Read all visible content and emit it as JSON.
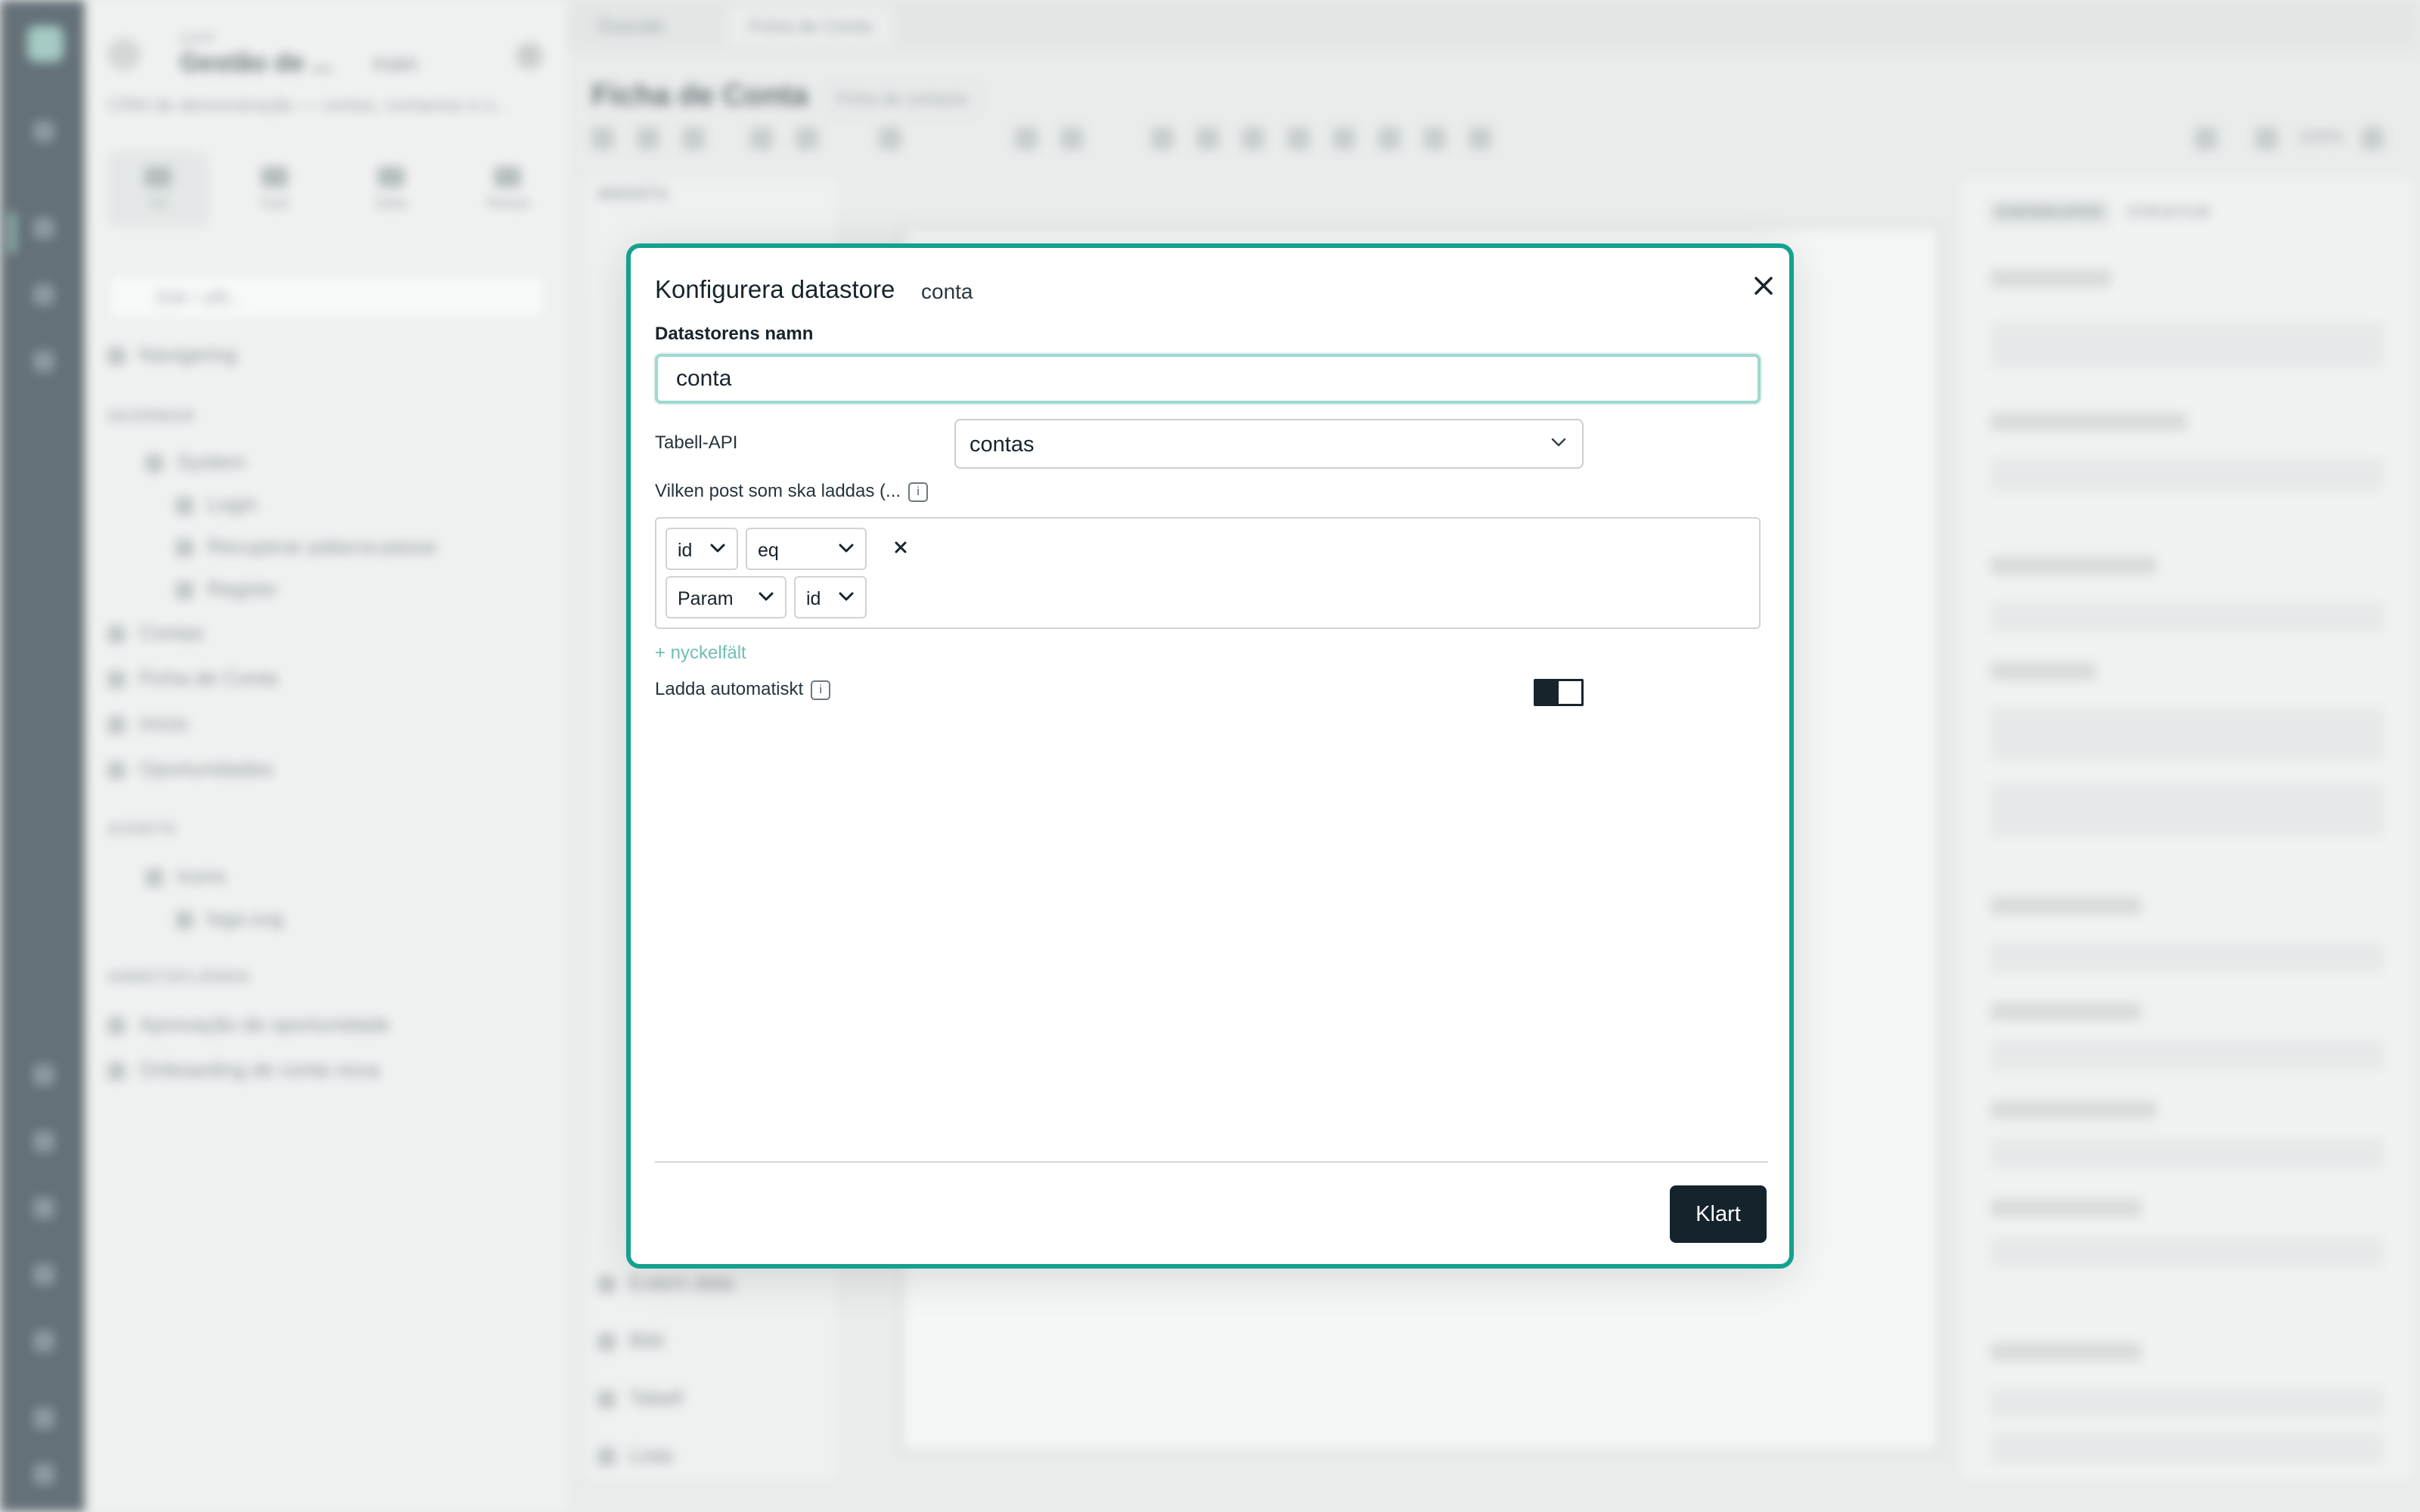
{
  "background": {
    "workspace": {
      "sup": "ip/AP",
      "title": "Gestão de ...",
      "branch": "main",
      "description": "CRM de demonstração — contas, contactos e o..."
    },
    "sidebar_tabs": [
      "UI",
      "Kod",
      "Data",
      "Teman"
    ],
    "search_placeholder": "Sök i allt...",
    "nav_top": "Navigering",
    "section_screens": "SKÄRMAR",
    "screens": [
      "System",
      "Login",
      "Recuperar palavra-passe",
      "Registo",
      "Contas",
      "Ficha de Conta",
      "Início",
      "Oportunidades"
    ],
    "section_assets": "ASSETS",
    "assets": [
      "Icons",
      "logo.svg"
    ],
    "section_workflows": "ARBETSFLÖDEN",
    "workflows": [
      "Aprovação de oportunidade",
      "Onboarding de conta nova"
    ],
    "tabs": [
      "Översikt",
      "Ficha de Conta"
    ],
    "page_title": "Ficha de Conta",
    "page_badge": "Ficha de contacto",
    "zoom": "100%",
    "widgets_header": "WIDGETS",
    "widgets_bottom": [
      "Extern data",
      "Bild",
      "Tabell",
      "Lista"
    ],
    "props_tabs": [
      "EGENSKAPER",
      "STRUKTUR"
    ]
  },
  "modal": {
    "title": "Konfigurera datastore",
    "subtitle": "conta",
    "name_label": "Datastorens namn",
    "name_value": "conta",
    "api_label": "Tabell-API",
    "api_value": "contas",
    "which_label": "Vilken post som ska laddas (...",
    "filter": {
      "field": "id",
      "operator": "eq",
      "source": "Param",
      "param": "id"
    },
    "add_key": "+ nyckelfält",
    "auto_label": "Ladda automatiskt",
    "auto_on": true,
    "done": "Klart"
  },
  "colors": {
    "accent": "#14a18e",
    "dark": "#14232c",
    "link": "#6fbfb2"
  }
}
